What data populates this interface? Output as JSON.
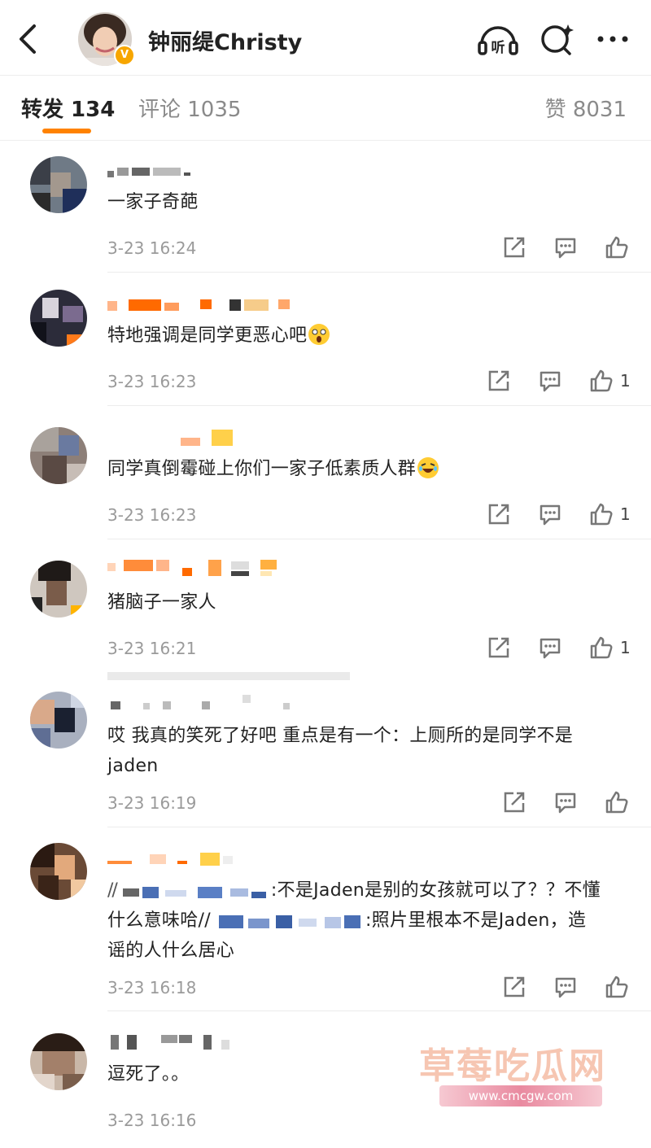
{
  "header": {
    "title": "钟丽缇Christy",
    "verified_badge": "V",
    "icons": [
      "back-icon",
      "listen-icon",
      "search-icon",
      "more-icon"
    ],
    "listen_label": "听"
  },
  "tabs": [
    {
      "label": "转发 134",
      "active": true
    },
    {
      "label": "评论 1035",
      "active": false
    }
  ],
  "likes_label": "赞 8031",
  "accent_color": "#ff8200",
  "comments": [
    {
      "text": "一家子奇葩",
      "time": "3-23 16:24",
      "like_count": ""
    },
    {
      "text": "特地强调是同学更恶心吧",
      "emoji": "shocked-emoji",
      "time": "3-23 16:23",
      "like_count": "1"
    },
    {
      "text": "同学真倒霉碰上你们一家子低素质人群",
      "emoji": "laughing-emoji",
      "time": "3-23 16:23",
      "like_count": "1"
    },
    {
      "text": "猪脑子一家人",
      "time": "3-23 16:21",
      "like_count": "1"
    },
    {
      "text_line1": "哎 我真的笑死了好吧 重点是有一个：上厕所的是同学不是",
      "text_line2": "jaden",
      "time": "3-23 16:19",
      "like_count": ""
    },
    {
      "text_line1_prefix": "//",
      "text_line1": ":不是Jaden是别的女孩就可以了？？不懂",
      "text_line2_prefix": "什么意味哈//",
      "text_line2": ":照片里根本不是Jaden，造",
      "text_line3": "谣的人什么居心",
      "time": "3-23 16:18",
      "like_count": ""
    },
    {
      "text": "逗死了。。",
      "time": "3-23 16:16",
      "like_count": ""
    }
  ],
  "watermark": {
    "text": "草莓吃瓜网",
    "url": "www.cmcgw.com"
  }
}
